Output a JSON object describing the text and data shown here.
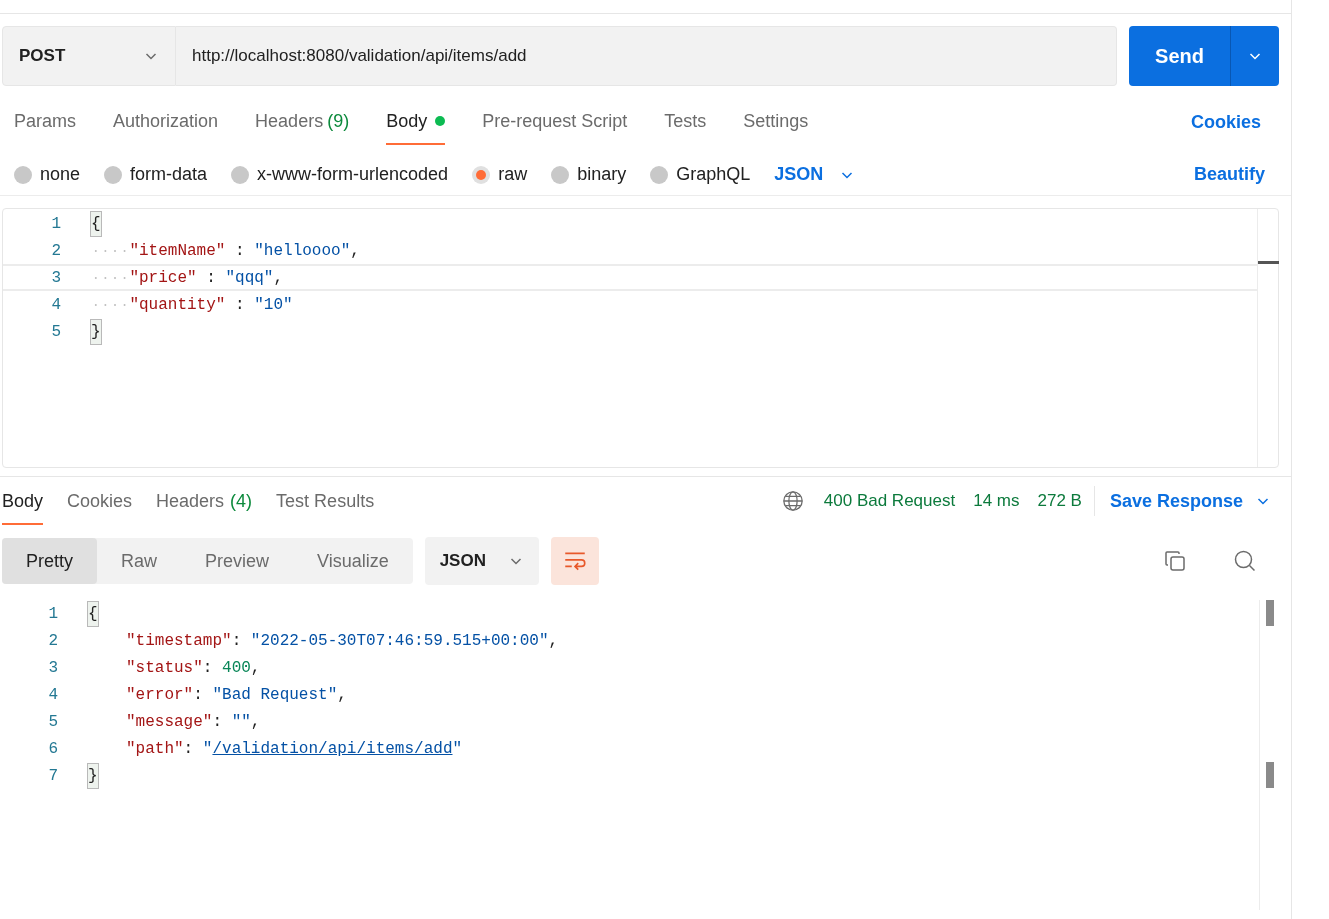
{
  "request": {
    "method": "POST",
    "url": "http://localhost:8080/validation/api/items/add",
    "send_label": "Send"
  },
  "request_tabs": [
    {
      "label": "Params",
      "selected": false
    },
    {
      "label": "Authorization",
      "selected": false
    },
    {
      "label": "Headers",
      "count": "(9)",
      "selected": false
    },
    {
      "label": "Body",
      "dot": true,
      "selected": true
    },
    {
      "label": "Pre-request Script",
      "selected": false
    },
    {
      "label": "Tests",
      "selected": false
    },
    {
      "label": "Settings",
      "selected": false
    }
  ],
  "cookies_link": "Cookies",
  "body_types": [
    {
      "label": "none",
      "selected": false
    },
    {
      "label": "form-data",
      "selected": false
    },
    {
      "label": "x-www-form-urlencoded",
      "selected": false
    },
    {
      "label": "raw",
      "selected": true
    },
    {
      "label": "binary",
      "selected": false
    },
    {
      "label": "GraphQL",
      "selected": false
    }
  ],
  "body_format": "JSON",
  "beautify_link": "Beautify",
  "request_editor": {
    "show_whitespace": true,
    "lines": [
      {
        "number": "1",
        "current": false,
        "kind": "bracket",
        "bracket": "{"
      },
      {
        "number": "2",
        "current": false,
        "kind": "string",
        "key": "\"itemName\"",
        "sep": ":",
        "value": "\"helloooo\"",
        "trail": ","
      },
      {
        "number": "3",
        "current": true,
        "kind": "string",
        "key": "\"price\"",
        "sep": ":",
        "value": "\"qqq\"",
        "trail": ","
      },
      {
        "number": "4",
        "current": false,
        "kind": "string",
        "key": "\"quantity\"",
        "sep": ":",
        "value": "\"10\""
      },
      {
        "number": "5",
        "current": false,
        "kind": "bracket",
        "bracket": "}"
      }
    ]
  },
  "response_tabs": [
    {
      "label": "Body",
      "selected": true
    },
    {
      "label": "Cookies",
      "selected": false
    },
    {
      "label": "Headers",
      "count": "(4)",
      "selected": false
    },
    {
      "label": "Test Results",
      "selected": false
    }
  ],
  "response_status": {
    "status": "400 Bad Request",
    "time": "14 ms",
    "size": "272 B",
    "save_label": "Save Response"
  },
  "view_modes": [
    {
      "label": "Pretty",
      "selected": true
    },
    {
      "label": "Raw",
      "selected": false
    },
    {
      "label": "Preview",
      "selected": false
    },
    {
      "label": "Visualize",
      "selected": false
    }
  ],
  "response_format": "JSON",
  "response_editor": {
    "show_whitespace": false,
    "lines": [
      {
        "number": "1",
        "current": false,
        "kind": "bracket",
        "bracket": "{"
      },
      {
        "number": "2",
        "current": false,
        "kind": "string",
        "key": "\"timestamp\"",
        "sep": ":",
        "value": "\"2022-05-30T07:46:59.515+00:00\"",
        "trail": ","
      },
      {
        "number": "3",
        "current": false,
        "kind": "number",
        "key": "\"status\"",
        "sep": ":",
        "value": "400",
        "trail": ","
      },
      {
        "number": "4",
        "current": false,
        "kind": "string",
        "key": "\"error\"",
        "sep": ":",
        "value": "\"Bad Request\"",
        "trail": ","
      },
      {
        "number": "5",
        "current": false,
        "kind": "string",
        "key": "\"message\"",
        "sep": ":",
        "value": "\"\"",
        "trail": ","
      },
      {
        "number": "6",
        "current": false,
        "kind": "link",
        "key": "\"path\"",
        "sep": ":",
        "value": "\"/validation/api/items/add\""
      },
      {
        "number": "7",
        "current": false,
        "kind": "bracket",
        "bracket": "}"
      }
    ]
  }
}
